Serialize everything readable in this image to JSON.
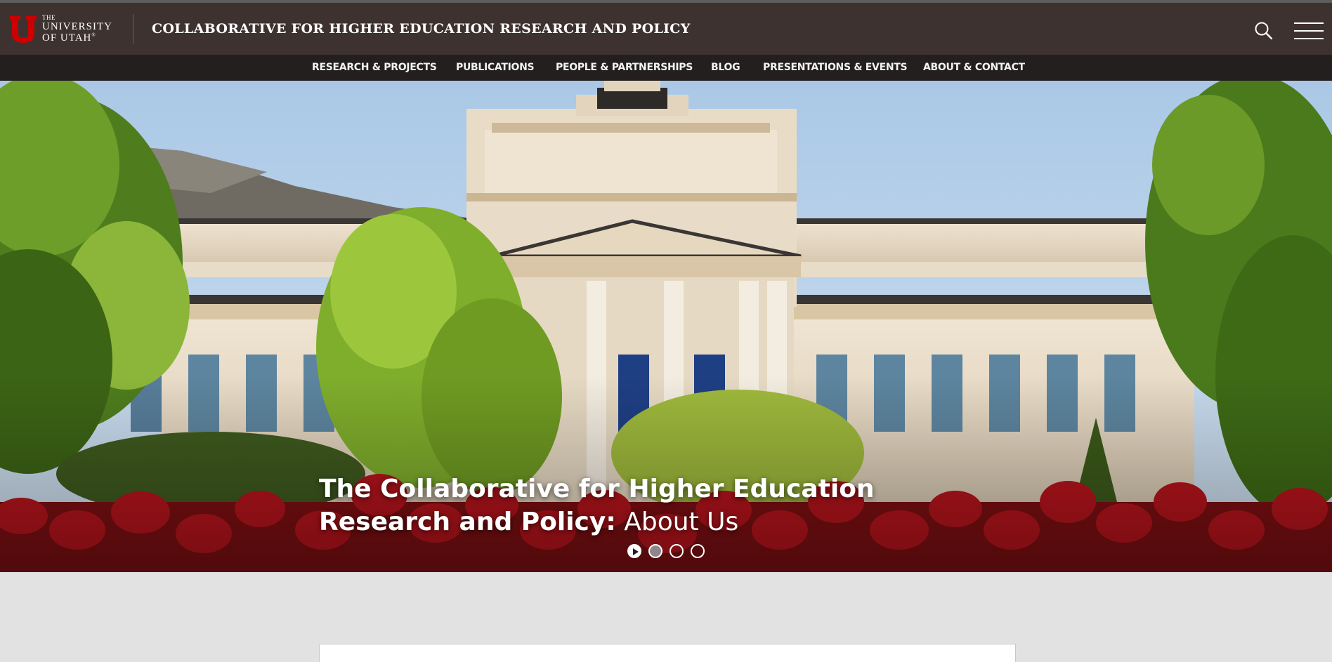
{
  "header": {
    "logo": {
      "line1": "THE",
      "line2": "UNIVERSITY",
      "line3": "OF UTAH",
      "registered": "®"
    },
    "site_title": "COLLABORATIVE FOR HIGHER EDUCATION RESEARCH AND POLICY",
    "search_icon": "search-icon",
    "menu_icon": "hamburger-menu-icon"
  },
  "nav": {
    "items": [
      {
        "label": "RESEARCH & PROJECTS"
      },
      {
        "label": "PUBLICATIONS"
      },
      {
        "label": "PEOPLE & PARTNERSHIPS"
      },
      {
        "label": "BLOG"
      },
      {
        "label": "PRESENTATIONS & EVENTS"
      },
      {
        "label": "ABOUT & CONTACT"
      }
    ]
  },
  "hero": {
    "title_bold": "The Collaborative for Higher Education Research and Policy:",
    "title_light": " About Us",
    "slides": 4,
    "active_slide": 1
  },
  "colors": {
    "header_bg": "#3e3230",
    "nav_bg": "#231f1f",
    "brand_red": "#cc0000",
    "page_bg": "#e2e2e2"
  }
}
